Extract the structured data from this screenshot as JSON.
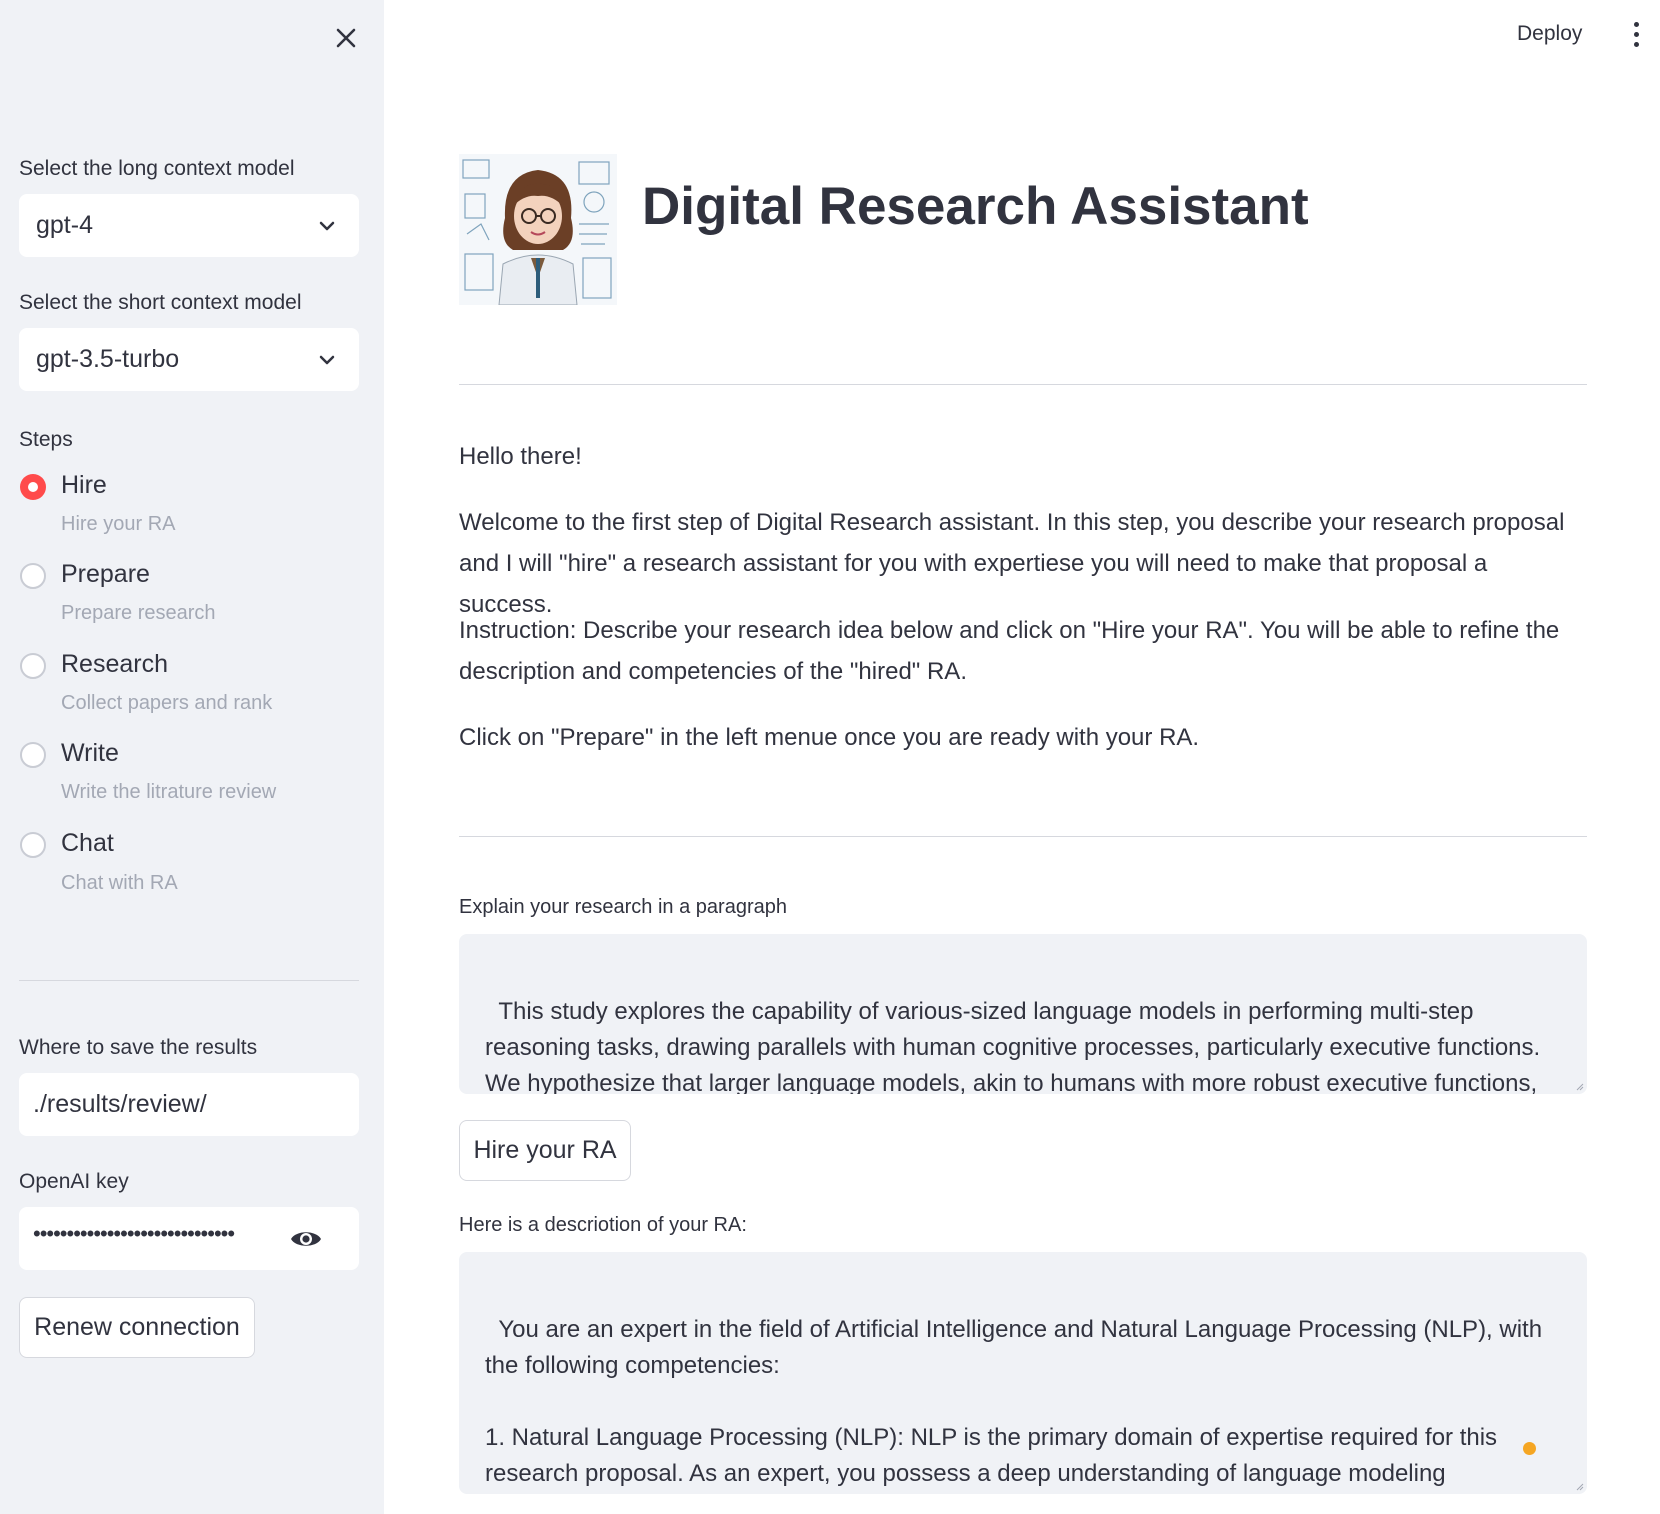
{
  "sidebar": {
    "long_model_label": "Select the long context model",
    "long_model_value": "gpt-4",
    "short_model_label": "Select the short context model",
    "short_model_value": "gpt-3.5-turbo",
    "steps_label": "Steps",
    "steps": [
      {
        "label": "Hire",
        "caption": "Hire your RA",
        "selected": true
      },
      {
        "label": "Prepare",
        "caption": "Prepare research",
        "selected": false
      },
      {
        "label": "Research",
        "caption": "Collect papers and rank",
        "selected": false
      },
      {
        "label": "Write",
        "caption": "Write the litrature review",
        "selected": false
      },
      {
        "label": "Chat",
        "caption": "Chat with RA",
        "selected": false
      }
    ],
    "save_label": "Where to save the results",
    "save_value": "./results/review/",
    "key_label": "OpenAI key",
    "key_masked": "••••••••••••••••••••••••••••••",
    "renew_button": "Renew connection"
  },
  "header": {
    "deploy": "Deploy",
    "menu_icon": "kebab-menu-icon"
  },
  "main": {
    "title": "Digital Research Assistant",
    "greeting": "Hello there!",
    "welcome": "Welcome to the first step of Digital Research assistant. In this step, you describe your research proposal and I will \"hire\" a research assistant for you with expertiese you will need to make that proposal a success.",
    "instruction": "Instruction: Describe your research idea below and click on \"Hire your RA\". You will be able to refine the description and competencies of the \"hired\" RA.",
    "next_step": "Click on \"Prepare\" in the left menue once you are ready with your RA.",
    "research_label": "Explain your research in a paragraph",
    "research_text": "This study explores the capability of various-sized language models in performing multi-step reasoning tasks, drawing parallels with human cognitive processes, particularly executive functions. We hypothesize that larger language models, akin to humans with more robust executive functions, demonstrate superior multi-layered reasoning abilities due to their increased capacity to represent",
    "hire_button": "Hire your RA",
    "ra_label": "Here is a descriotion of your RA:",
    "ra_text": "You are an expert in the field of Artificial Intelligence and Natural Language Processing (NLP), with the following competencies:\n\n1. Natural Language Processing (NLP): NLP is the primary domain of expertise required for this research proposal. As an expert, you possess a deep understanding of language modeling techniques, including recurrent neural networks (RNNs), transformers, and their application in"
  },
  "colors": {
    "accent": "#ff4b4b",
    "sidebar_bg": "#f0f2f6",
    "text": "#31333f",
    "caption": "#a3a8b4",
    "status": "#f5a623"
  }
}
